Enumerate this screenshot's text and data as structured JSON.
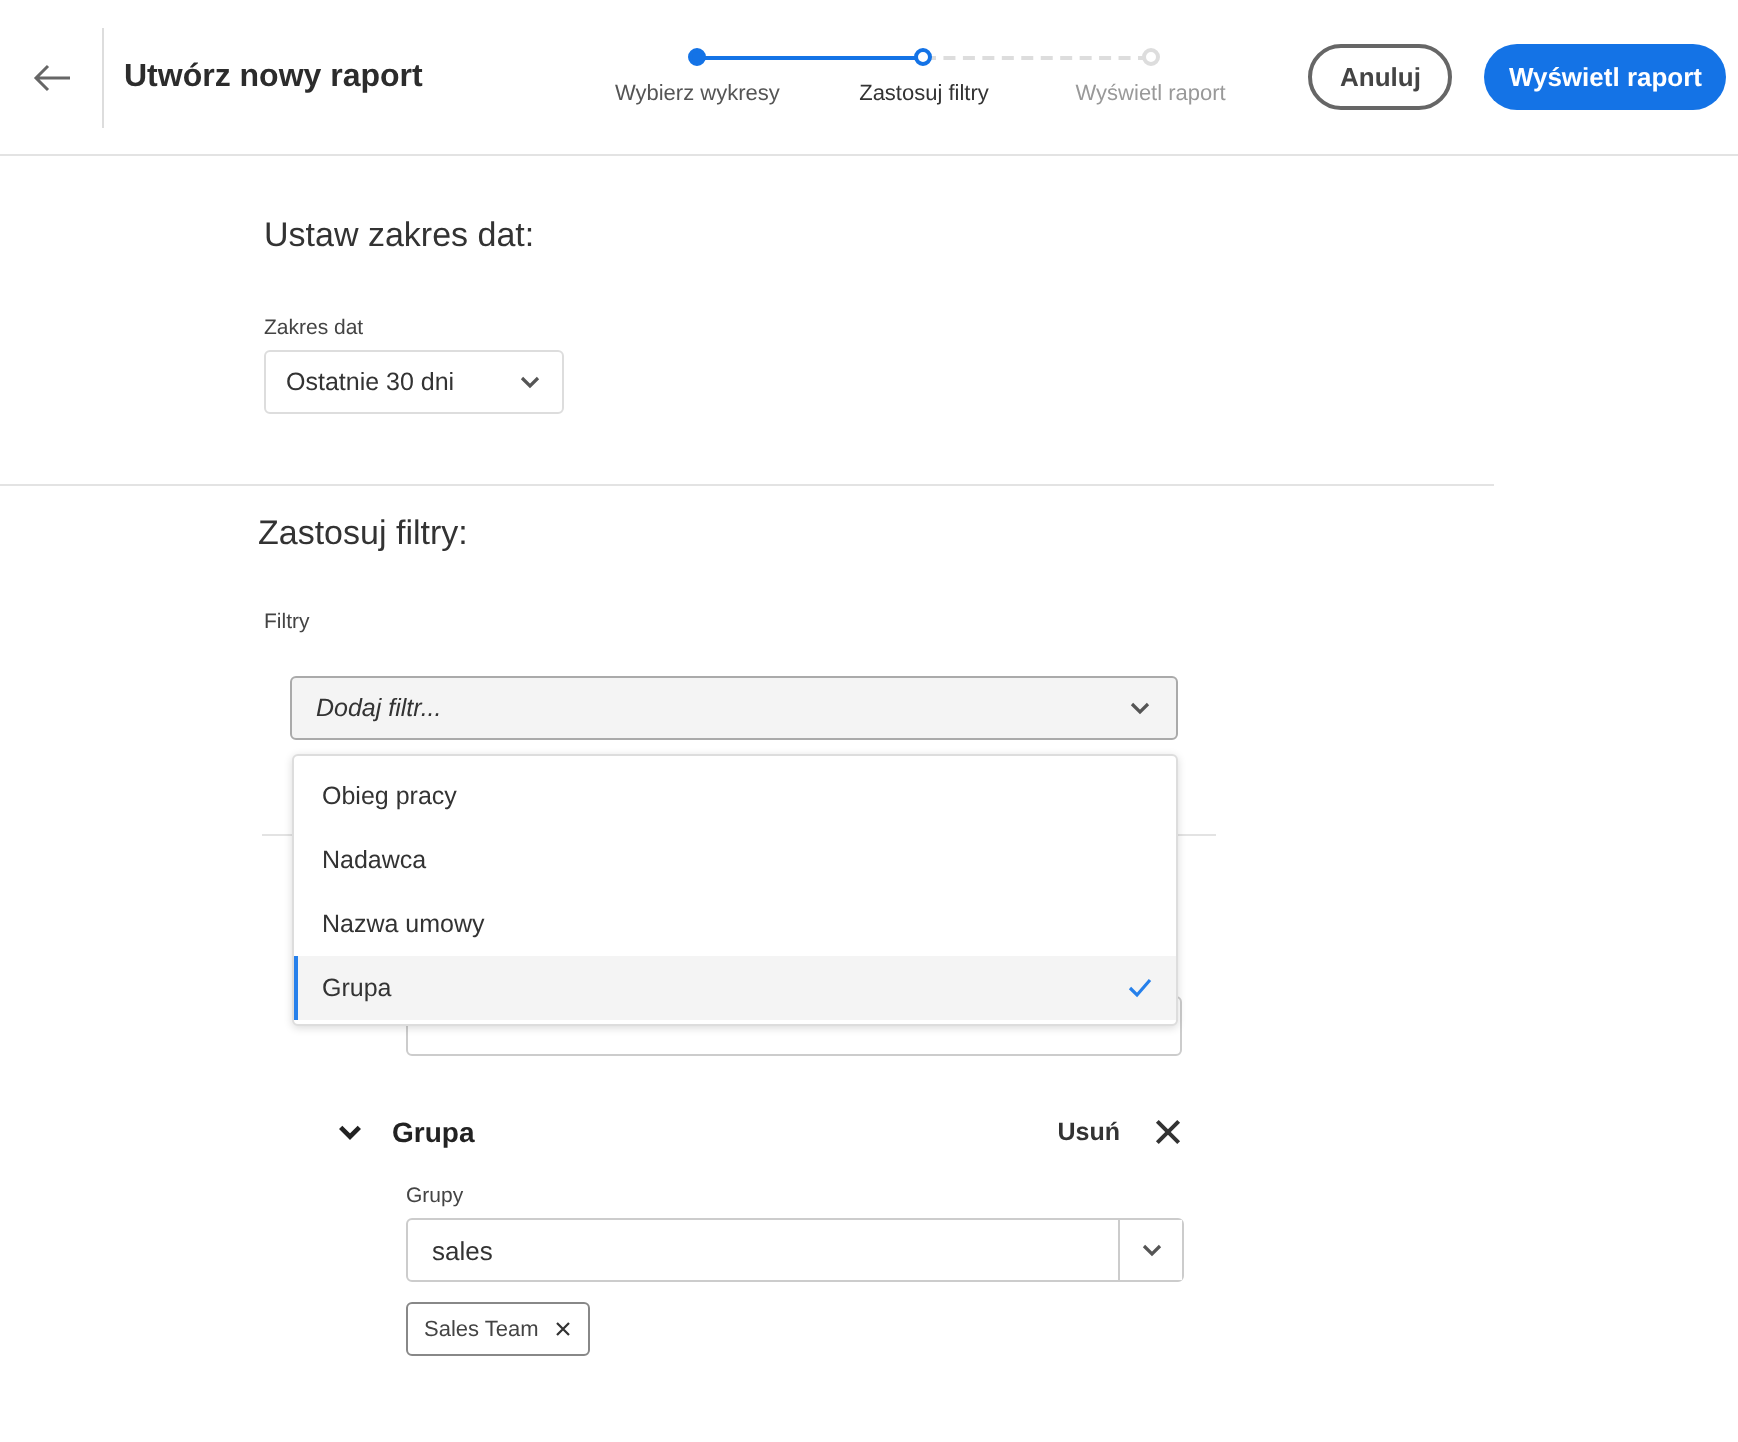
{
  "header": {
    "title": "Utwórz nowy raport",
    "steps": [
      {
        "label": "Wybierz wykresy",
        "completed": true,
        "selected": false
      },
      {
        "label": "Zastosuj filtry",
        "completed": false,
        "selected": true
      },
      {
        "label": "Wyświetl raport",
        "completed": false,
        "selected": false
      }
    ],
    "cancel": "Anuluj",
    "primary": "Wyświetl raport"
  },
  "date_section": {
    "title": "Ustaw zakres dat:",
    "label": "Zakres dat",
    "value": "Ostatnie 30 dni"
  },
  "filter_section": {
    "title": "Zastosuj filtry:",
    "label": "Filtry",
    "placeholder": "Dodaj filtr...",
    "menu_open": true,
    "menu": [
      {
        "label": "Obieg pracy",
        "selected": false
      },
      {
        "label": "Nadawca",
        "selected": false
      },
      {
        "label": "Nazwa umowy",
        "selected": false
      },
      {
        "label": "Grupa",
        "selected": true
      }
    ],
    "group": {
      "title": "Grupa",
      "expanded": true,
      "remove": "Usuń",
      "label": "Grupy",
      "value": "sales",
      "tags": [
        "Sales Team"
      ]
    }
  }
}
